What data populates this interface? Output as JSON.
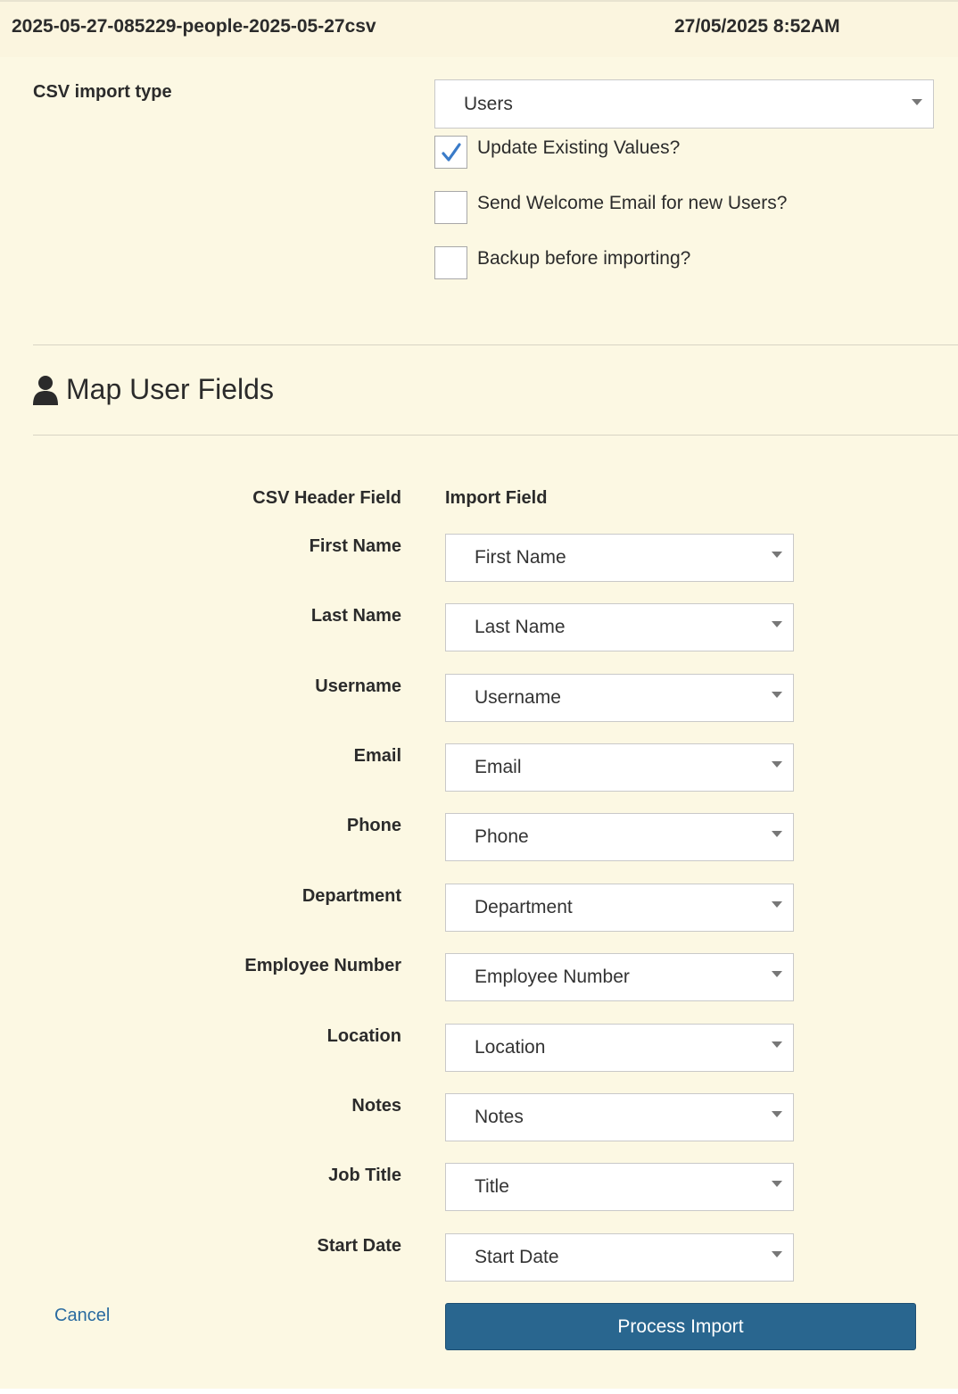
{
  "header": {
    "filename": "2025-05-27-085229-people-2025-05-27csv",
    "timestamp": "27/05/2025 8:52AM"
  },
  "import_type": {
    "label": "CSV import type",
    "selected": "Users"
  },
  "options": [
    {
      "label": "Update Existing Values?",
      "checked": true
    },
    {
      "label": "Send Welcome Email for new Users?",
      "checked": false
    },
    {
      "label": "Backup before importing?",
      "checked": false
    }
  ],
  "section": {
    "title": "Map User Fields",
    "icon": "user-icon"
  },
  "mapping": {
    "header_csv": "CSV Header Field",
    "header_import": "Import Field",
    "rows": [
      {
        "csv": "First Name",
        "import": "First Name"
      },
      {
        "csv": "Last Name",
        "import": "Last Name"
      },
      {
        "csv": "Username",
        "import": "Username"
      },
      {
        "csv": "Email",
        "import": "Email"
      },
      {
        "csv": "Phone",
        "import": "Phone"
      },
      {
        "csv": "Department",
        "import": "Department"
      },
      {
        "csv": "Employee Number",
        "import": "Employee Number"
      },
      {
        "csv": "Location",
        "import": "Location"
      },
      {
        "csv": "Notes",
        "import": "Notes"
      },
      {
        "csv": "Job Title",
        "import": "Title"
      },
      {
        "csv": "Start Date",
        "import": "Start Date"
      }
    ]
  },
  "actions": {
    "cancel": "Cancel",
    "process": "Process Import"
  },
  "colors": {
    "background": "#fcf8e3",
    "primary_button": "#29668f",
    "link": "#2a6ba0",
    "checkmark": "#3a7bc8"
  }
}
